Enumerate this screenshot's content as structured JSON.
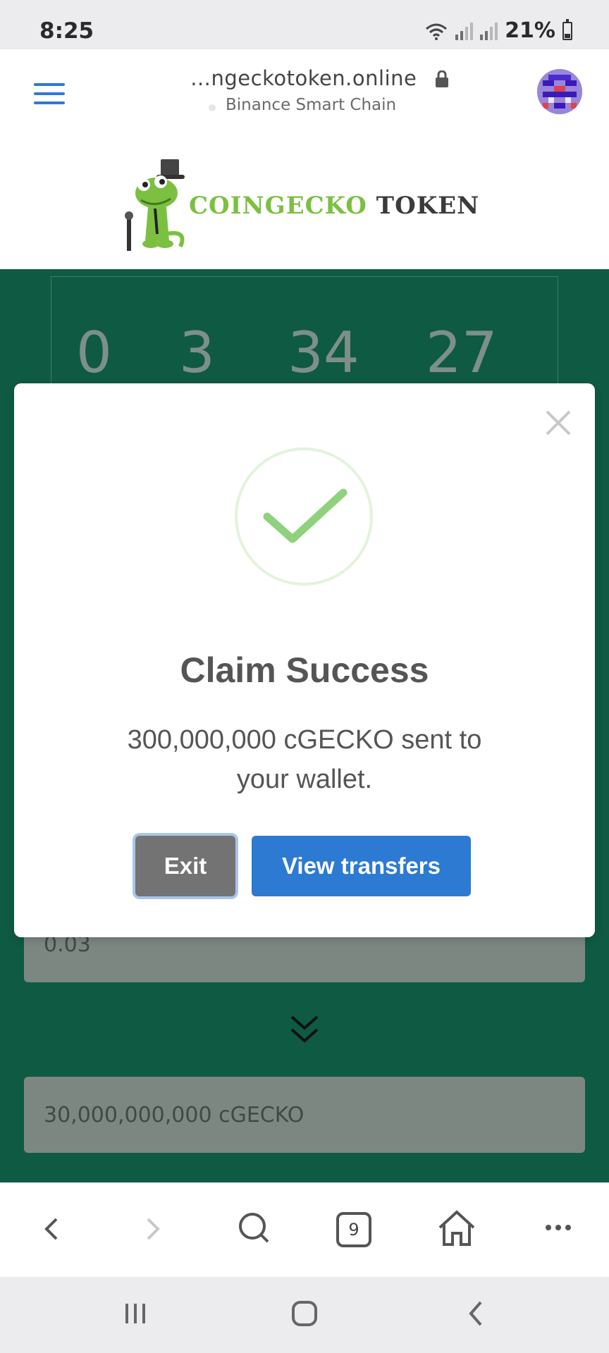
{
  "status_bar": {
    "time": "8:25",
    "battery": "21%"
  },
  "browser": {
    "url": "…ngeckotoken.online",
    "network": "Binance Smart Chain",
    "tab_count": "9"
  },
  "logo": {
    "part1": "COINGECKO",
    "part2": "TOKEN"
  },
  "countdown": [
    "0",
    "3",
    "34",
    "27"
  ],
  "fields": {
    "amount": "0.03",
    "receive": "30,000,000,000 cGECKO"
  },
  "modal": {
    "title": "Claim Success",
    "message": "300,000,000 cGECKO sent to your wallet.",
    "exit_label": "Exit",
    "view_label": "View transfers"
  },
  "colors": {
    "primary_green": "#0f5a42",
    "button_blue": "#2c7ad1",
    "logo_green": "#7cc042",
    "success_check": "#8fd17c"
  }
}
